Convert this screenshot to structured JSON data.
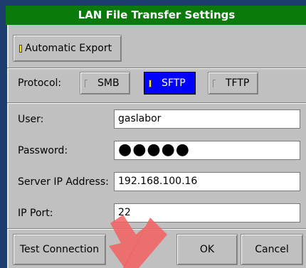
{
  "dialog": {
    "title": "LAN File Transfer Settings",
    "automatic_export_label": "Automatic Export",
    "automatic_export_checked": true
  },
  "protocol": {
    "label": "Protocol:",
    "options": [
      {
        "label": "SMB",
        "selected": false
      },
      {
        "label": "SFTP",
        "selected": true
      },
      {
        "label": "TFTP",
        "selected": false
      }
    ]
  },
  "fields": {
    "user_label": "User:",
    "user_value": "gaslabor",
    "password_label": "Password:",
    "password_value": "●●●●●",
    "server_label": "Server IP Address:",
    "server_value": "192.168.100.16",
    "port_label": "IP Port:",
    "port_value": "22"
  },
  "buttons": {
    "test_connection": "Test Connection",
    "ok": "OK",
    "cancel": "Cancel"
  },
  "colors": {
    "title_bar": "#0a7a0a",
    "selected_option": "#0000ff",
    "indicator_on": "#ffe800",
    "annotation_arrow": "#f26060"
  }
}
